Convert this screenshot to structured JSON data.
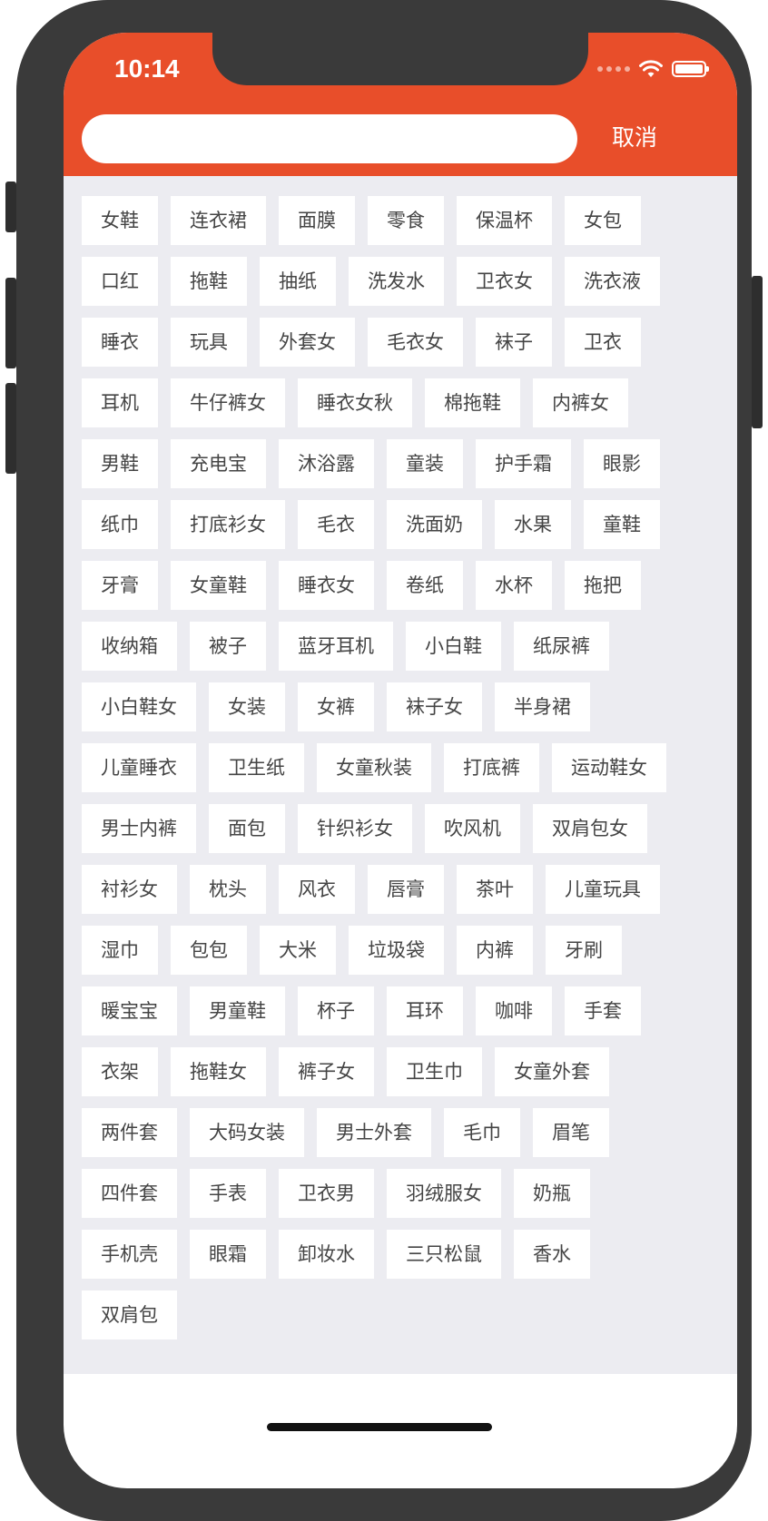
{
  "status_bar": {
    "time": "10:14"
  },
  "search": {
    "value": "",
    "placeholder": ""
  },
  "header": {
    "cancel_label": "取消"
  },
  "tags": [
    "女鞋",
    "连衣裙",
    "面膜",
    "零食",
    "保温杯",
    "女包",
    "口红",
    "拖鞋",
    "抽纸",
    "洗发水",
    "卫衣女",
    "洗衣液",
    "睡衣",
    "玩具",
    "外套女",
    "毛衣女",
    "袜子",
    "卫衣",
    "耳机",
    "牛仔裤女",
    "睡衣女秋",
    "棉拖鞋",
    "内裤女",
    "男鞋",
    "充电宝",
    "沐浴露",
    "童装",
    "护手霜",
    "眼影",
    "纸巾",
    "打底衫女",
    "毛衣",
    "洗面奶",
    "水果",
    "童鞋",
    "牙膏",
    "女童鞋",
    "睡衣女",
    "卷纸",
    "水杯",
    "拖把",
    "收纳箱",
    "被子",
    "蓝牙耳机",
    "小白鞋",
    "纸尿裤",
    "小白鞋女",
    "女装",
    "女裤",
    "袜子女",
    "半身裙",
    "儿童睡衣",
    "卫生纸",
    "女童秋装",
    "打底裤",
    "运动鞋女",
    "男士内裤",
    "面包",
    "针织衫女",
    "吹风机",
    "双肩包女",
    "衬衫女",
    "枕头",
    "风衣",
    "唇膏",
    "茶叶",
    "儿童玩具",
    "湿巾",
    "包包",
    "大米",
    "垃圾袋",
    "内裤",
    "牙刷",
    "暖宝宝",
    "男童鞋",
    "杯子",
    "耳环",
    "咖啡",
    "手套",
    "衣架",
    "拖鞋女",
    "裤子女",
    "卫生巾",
    "女童外套",
    "两件套",
    "大码女装",
    "男士外套",
    "毛巾",
    "眉笔",
    "四件套",
    "手表",
    "卫衣男",
    "羽绒服女",
    "奶瓶",
    "手机壳",
    "眼霜",
    "卸妆水",
    "三只松鼠",
    "香水",
    "双肩包"
  ],
  "colors": {
    "accent": "#e84e2a",
    "tag_area_bg": "#ececf1",
    "tag_bg": "#ffffff",
    "tag_text": "#444444"
  },
  "icons": {
    "wifi": "wifi-icon",
    "battery": "battery-icon",
    "signal": "signal-dots-icon"
  }
}
